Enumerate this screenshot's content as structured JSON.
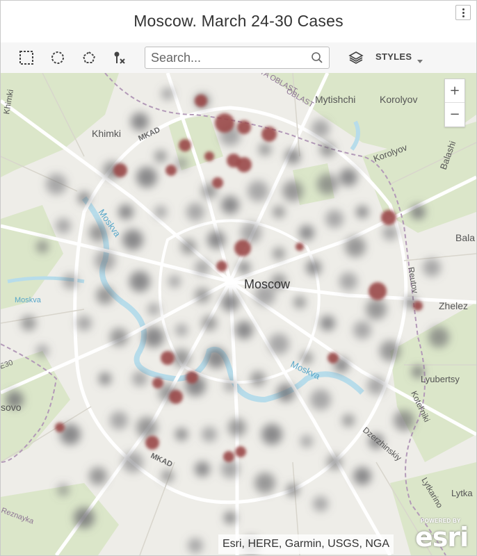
{
  "header": {
    "title": "Moscow. March 24-30 Cases"
  },
  "toolbar": {
    "search_placeholder": "Search...",
    "styles_label": "STYLES"
  },
  "map": {
    "labels": {
      "city": "Moscow",
      "places": [
        "Mytishchi",
        "Korolyov",
        "Khimki",
        "Khimki",
        "Korolyov",
        "Balashi",
        "Bala",
        "Zhelez",
        "Lyubertsy",
        "Kotel'niki",
        "Dzerzhinskiy",
        "Lytkarino",
        "Lytka",
        "sovo",
        "Reutov"
      ],
      "roads": [
        "MKAD",
        "MKAD",
        "E30"
      ],
      "rivers": [
        "Moskva",
        "Moskva",
        "Moskva"
      ],
      "regions": [
        "OBLAST",
        "YA OBLAST",
        "Reznayka"
      ]
    },
    "zoom_in": "+",
    "zoom_out": "−"
  },
  "attribution": "Esri, HERE, Garmin, USGS, NGA",
  "branding": {
    "powered_by": "POWERED BY",
    "logo": "esri"
  },
  "colors": {
    "hotspot": "#9a4848",
    "heat_gray": "#6e6e72",
    "park": "#dbe6c9",
    "water": "#b7dcea",
    "road": "#ffffff",
    "boundary": "#b39ab8"
  }
}
